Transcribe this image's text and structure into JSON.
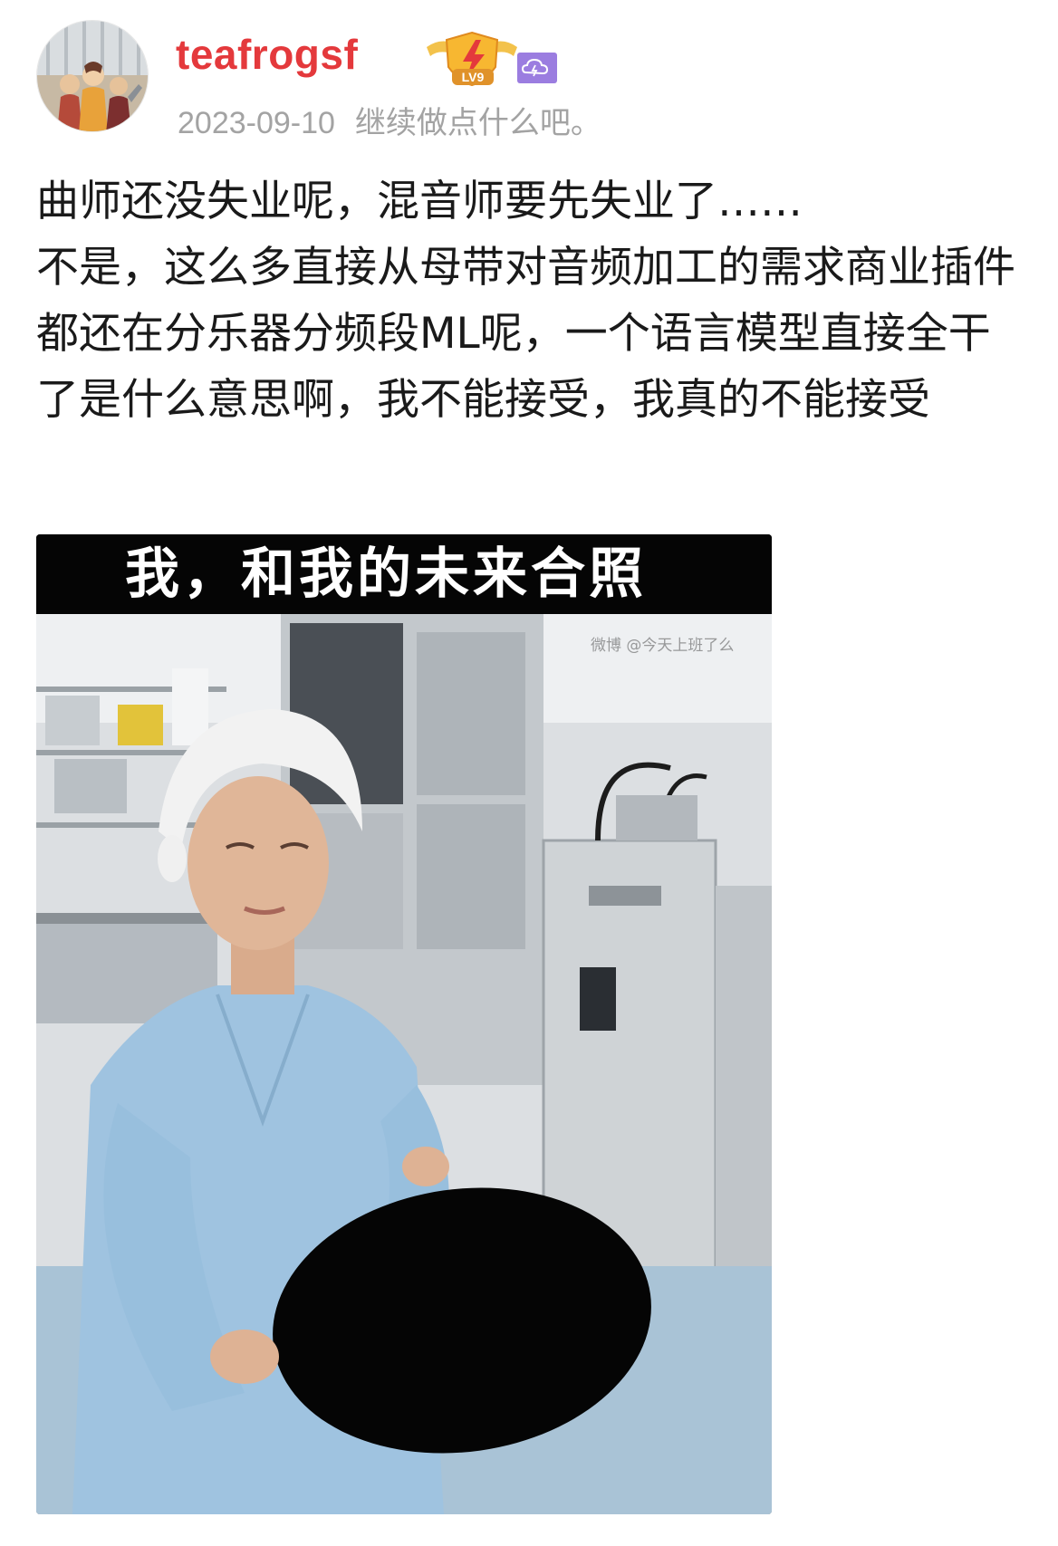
{
  "post": {
    "author": {
      "username": "teafrogsf",
      "level_label": "LV9",
      "avatar": "avatar-illustration"
    },
    "date": "2023-09-10",
    "signature": "继续做点什么吧。",
    "text_lines": [
      "曲师还没失业呢，混音师要先失业了……",
      "不是，这么多直接从母带对音频加工的需求商业插件都还在分乐器分频段ML呢，一个语言模型直接全干了是什么意思啊，我不能接受，我真的不能接受"
    ],
    "image": {
      "caption": "我，和我的未来合照",
      "watermark": "微博 @今天上班了么"
    }
  },
  "icons": {
    "badge": "level-lightning-badge",
    "vip": "vip-cloud-badge"
  },
  "colors": {
    "username": "#e4393c",
    "meta": "#a3a3a3",
    "body_text": "#1a1a1a",
    "caption_bar": "#050505"
  }
}
